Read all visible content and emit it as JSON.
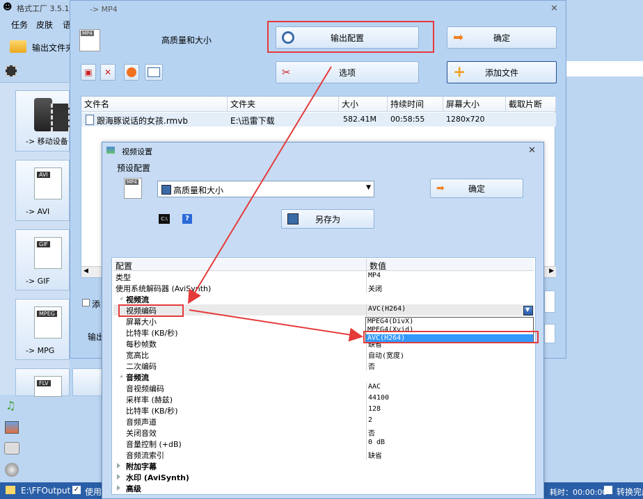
{
  "main": {
    "title": "格式工厂 3.5.1",
    "menu": [
      "任务",
      "皮肤",
      "语"
    ],
    "output_folder_btn": "输出文件夹",
    "sidebar": [
      {
        "label": "-> 移动设备"
      },
      {
        "label": "-> AVI",
        "tag": "AVI"
      },
      {
        "label": "-> GIF",
        "tag": "GIF"
      },
      {
        "label": "-> MPG",
        "tag": "MPEG"
      },
      {
        "label": "",
        "tag": "FLV"
      }
    ],
    "status": {
      "path": "E:\\FFOutput",
      "use_label": "使用",
      "elapsed": "耗时：00:00:00",
      "after_convert": "转换完成"
    }
  },
  "mp4_dialog": {
    "title": "-> MP4",
    "preset": "高质量和大小",
    "output_config_btn": "输出配置",
    "ok_btn": "确定",
    "options_btn": "选项",
    "add_file_btn": "添加文件",
    "columns": [
      "文件名",
      "文件夹",
      "大小",
      "持续时间",
      "屏幕大小",
      "截取片断"
    ],
    "files": [
      {
        "name": "跟海豚说话的女孩.rmvb",
        "folder": "E:\\迅雷下载",
        "size": "582.41M",
        "duration": "00:58:55",
        "screen": "1280x720"
      }
    ],
    "add_check_label": "添",
    "output_label": "输出"
  },
  "video_dialog": {
    "title": "视频设置",
    "preset_label": "预设配置",
    "preset_value": "高质量和大小",
    "ok_btn": "确定",
    "save_as_btn": "另存为",
    "header_key": "配置",
    "header_val": "数值",
    "rows": [
      {
        "k": "类型",
        "v": "MP4"
      },
      {
        "k": "使用系统解码器 (AviSynth)",
        "v": "关闭"
      },
      {
        "k": "视频流",
        "v": "",
        "section": true
      },
      {
        "k": "视频编码",
        "v": "AVC(H264)",
        "sub": true,
        "highlight": true
      },
      {
        "k": "屏幕大小",
        "v": "",
        "sub": true
      },
      {
        "k": "比特率 (KB/秒)",
        "v": "",
        "sub": true
      },
      {
        "k": "每秒帧数",
        "v": "缺省",
        "sub": true
      },
      {
        "k": "宽高比",
        "v": "自动(宽度)",
        "sub": true
      },
      {
        "k": "二次编码",
        "v": "否",
        "sub": true
      },
      {
        "k": "音频流",
        "v": "",
        "section": true
      },
      {
        "k": "音视频编码",
        "v": "AAC",
        "sub": true
      },
      {
        "k": "采样率 (赫兹)",
        "v": "44100",
        "sub": true
      },
      {
        "k": "比特率 (KB/秒)",
        "v": "128",
        "sub": true
      },
      {
        "k": "音频声道",
        "v": "2",
        "sub": true
      },
      {
        "k": "关闭音效",
        "v": "否",
        "sub": true
      },
      {
        "k": "音量控制 (+dB)",
        "v": "0 dB",
        "sub": true
      },
      {
        "k": "音频流索引",
        "v": "缺省",
        "sub": true
      },
      {
        "k": "附加字幕",
        "v": "",
        "section": true,
        "collapsed": true
      },
      {
        "k": "水印 (AviSynth)",
        "v": "",
        "section": true,
        "collapsed": true
      },
      {
        "k": "高级",
        "v": "",
        "section": true,
        "collapsed": true
      }
    ],
    "codec_options": [
      "MPEG4(DivX)",
      "MPEG4(Xvid)",
      "AVC(H264)"
    ],
    "codec_selected_index": 2
  },
  "colors": {
    "accent_red": "#e53a3a",
    "selection_blue": "#3399ff"
  }
}
